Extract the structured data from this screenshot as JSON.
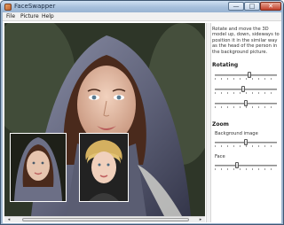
{
  "window": {
    "title": "FaceSwapper"
  },
  "menu": {
    "items": [
      "File",
      "Picture",
      "Help"
    ]
  },
  "window_buttons": {
    "minimize": "—",
    "maximize": "□",
    "close": "✕"
  },
  "side_panel": {
    "instructions": "Rotate and move the 3D model up, down, sideways to position it in the similar way as the head of the person in the background picture.",
    "rotating_heading": "Rotating",
    "zoom_heading": "Zoom",
    "background_image_label": "Background image",
    "face_label": "Face",
    "rotating_levels": [
      0.55,
      0.45,
      0.5
    ],
    "background_image_zoom_level": 0.5,
    "face_zoom_level": 0.35
  },
  "scrollbar": {
    "left_arrow": "◂",
    "right_arrow": "▸"
  },
  "colors": {
    "hood": "#6b6f86",
    "hood_dark": "#3d3f52",
    "skin": "#e8c0a8",
    "hair": "#5a2e1a",
    "blonde": "#e0c070"
  }
}
